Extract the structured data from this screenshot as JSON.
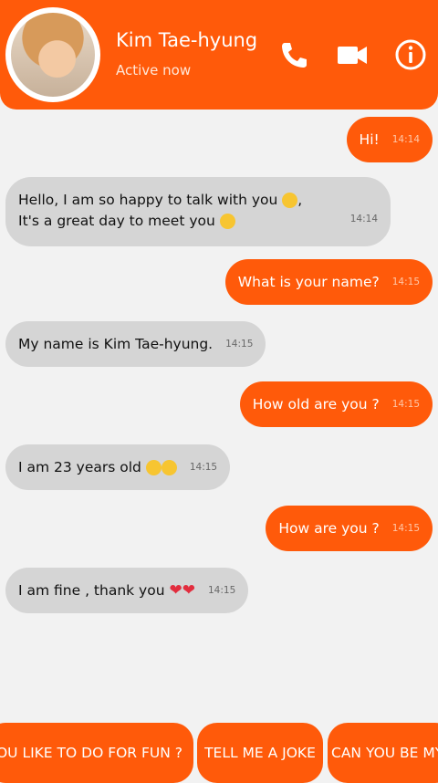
{
  "header": {
    "contact_name": "Kim Tae-hyung",
    "status": "Active now",
    "icons": [
      "phone-icon",
      "video-camera-icon",
      "info-icon"
    ]
  },
  "messages": [
    {
      "side": "sent",
      "text": "Hi!",
      "time": "14:14"
    },
    {
      "side": "received",
      "line1": "Hello, I am so happy to talk with you",
      "line2": "It's a great day to meet you",
      "time": "14:14"
    },
    {
      "side": "sent",
      "text": "What is your name?",
      "time": "14:15"
    },
    {
      "side": "received",
      "text": "My name is Kim Tae-hyung.",
      "time": "14:15"
    },
    {
      "side": "sent",
      "text": "How old are you ?",
      "time": "14:15"
    },
    {
      "side": "received",
      "text": "I am 23 years old",
      "time": "14:15"
    },
    {
      "side": "sent",
      "text": "How are you ?",
      "time": "14:15"
    },
    {
      "side": "received",
      "text": "I am fine , thank you",
      "time": "14:15"
    }
  ],
  "suggestions": [
    "OU LIKE TO DO FOR FUN ?",
    "TELL ME A JOKE",
    "CAN YOU BE MY"
  ],
  "colors": {
    "accent": "#ff5a0a",
    "received_bubble": "#d5d5d5",
    "background": "#f2f2f2"
  }
}
